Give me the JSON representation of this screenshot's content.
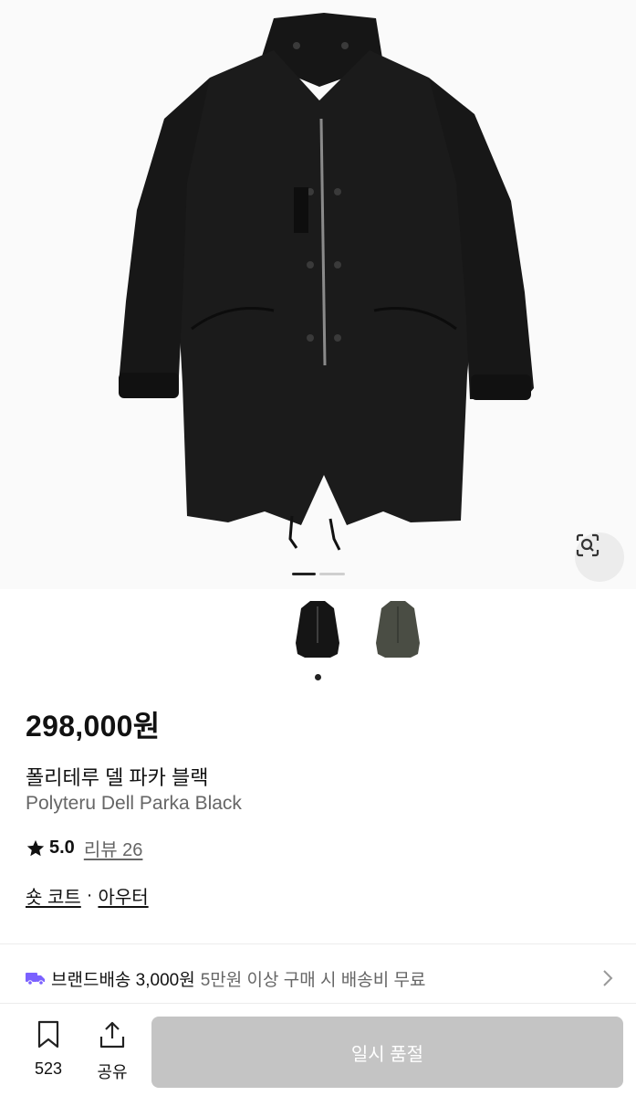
{
  "product": {
    "price": "298,000원",
    "name_ko": "폴리테루 델 파카 블랙",
    "name_en": "Polyteru Dell Parka Black"
  },
  "rating": {
    "score": "5.0",
    "review_link": "리뷰 26"
  },
  "category": {
    "primary": "숏 코트",
    "separator": "·",
    "secondary": "아우터"
  },
  "shipping": {
    "label": "브랜드배송 3,000원",
    "note": "5만원 이상 구매 시 배송비 무료"
  },
  "actions": {
    "wish_count": "523",
    "share_label": "공유",
    "buy_label": "일시 품절"
  },
  "gallery": {
    "current_index": 1,
    "total": 2,
    "thumbnail_count": 2
  },
  "colors": {
    "accent": "#7b61ff",
    "disabled": "#c4c4c4",
    "jacket_black": "#1a1a1a",
    "jacket_olive": "#4a4d44"
  },
  "icons": [
    "camera-search-icon",
    "star-icon",
    "truck-icon",
    "chevron-right-icon",
    "bookmark-icon",
    "share-icon"
  ]
}
